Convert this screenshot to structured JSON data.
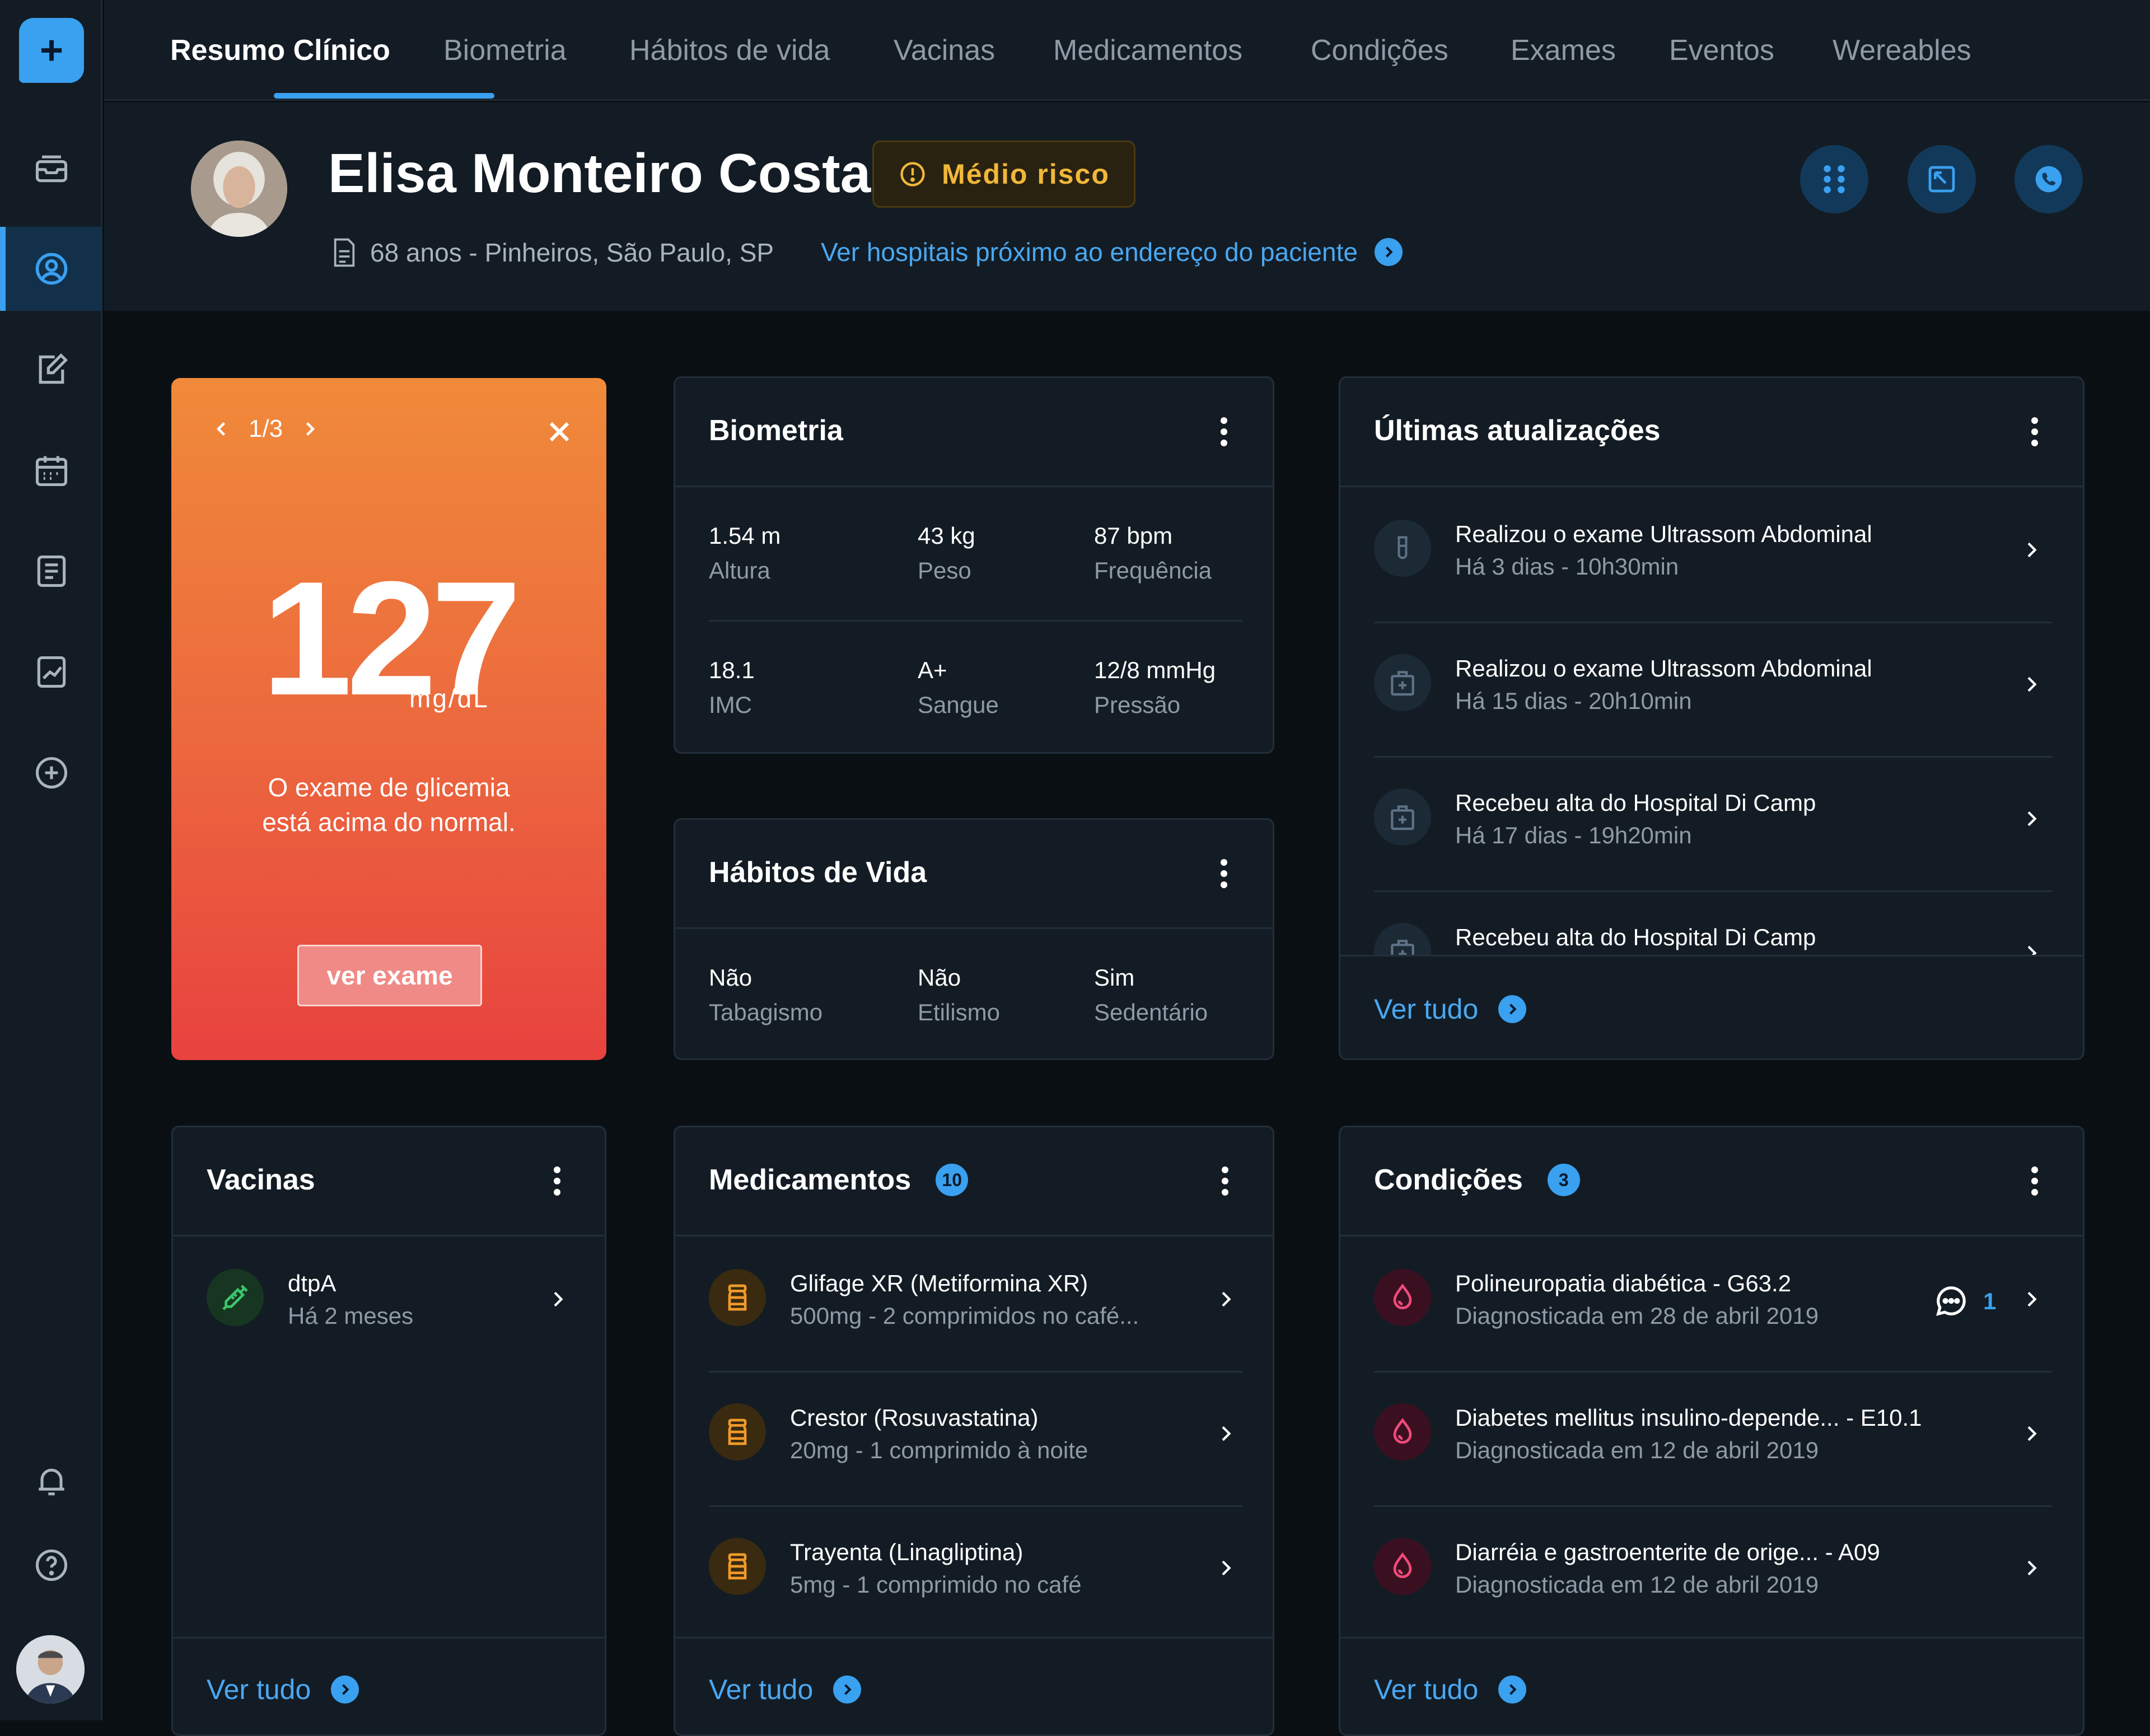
{
  "sidebar": {
    "items": [
      "inbox-icon",
      "user-circle-icon",
      "edit-icon",
      "calendar-icon",
      "document-icon",
      "chart-icon",
      "plus-circle-icon",
      "bell-icon",
      "help-icon"
    ],
    "active": "user-circle-icon",
    "accent": "#3aa0f0"
  },
  "tabs": [
    "Resumo Clínico",
    "Biometria",
    "Hábitos de vida",
    "Vacinas",
    "Medicamentos",
    "Condições",
    "Exames",
    "Eventos",
    "Wereables"
  ],
  "patient": {
    "name": "Elisa Monteiro Costa",
    "risk": "Médio risco",
    "info": "68 anos - Pinheiros, São Paulo, SP",
    "hospital_link": "Ver hospitais próximo ao endereço do paciente"
  },
  "alert": {
    "pager": "1/3",
    "value": "127",
    "unit": "mg/dL",
    "message_line1": "O exame de glicemia",
    "message_line2": "está acima do normal.",
    "button": "ver exame"
  },
  "biometria": {
    "title": "Biometria",
    "metrics": [
      {
        "value": "1.54 m",
        "label": "Altura"
      },
      {
        "value": "43 kg",
        "label": "Peso"
      },
      {
        "value": "87 bpm",
        "label": "Frequência"
      },
      {
        "value": "18.1",
        "label": "IMC"
      },
      {
        "value": "A+",
        "label": "Sangue"
      },
      {
        "value": "12/8 mmHg",
        "label": "Pressão"
      }
    ]
  },
  "habitos": {
    "title": "Hábitos de Vida",
    "metrics": [
      {
        "value": "Não",
        "label": "Tabagismo"
      },
      {
        "value": "Não",
        "label": "Etilismo"
      },
      {
        "value": "Sim",
        "label": "Sedentário"
      }
    ]
  },
  "updates": {
    "title": "Últimas atualizações",
    "items": [
      {
        "title": "Realizou o exame Ultrassom Abdominal",
        "subtitle": "Há 3 dias - 10h30min",
        "icon": "test-tube-icon"
      },
      {
        "title": "Realizou o exame Ultrassom Abdominal",
        "subtitle": "Há 15 dias - 20h10min",
        "icon": "hospital-icon"
      },
      {
        "title": "Recebeu alta do Hospital Di Camp",
        "subtitle": "Há 17 dias - 19h20min",
        "icon": "hospital-icon"
      },
      {
        "title": "Recebeu alta do Hospital Di Camp",
        "subtitle": "",
        "icon": "hospital-icon"
      }
    ],
    "see_all": "Ver tudo"
  },
  "vacinas": {
    "title": "Vacinas",
    "items": [
      {
        "title": "dtpA",
        "subtitle": "Há 2 meses",
        "icon": "syringe-icon"
      }
    ],
    "see_all": "Ver tudo"
  },
  "medicamentos": {
    "title": "Medicamentos",
    "count": "10",
    "items": [
      {
        "title": "Glifage XR (Metiformina XR)",
        "subtitle": "500mg - 2 comprimidos no café..."
      },
      {
        "title": "Crestor (Rosuvastatina)",
        "subtitle": "20mg - 1 comprimido à noite"
      },
      {
        "title": "Trayenta (Linagliptina)",
        "subtitle": "5mg - 1 comprimido no café"
      }
    ],
    "see_all": "Ver tudo"
  },
  "condicoes": {
    "title": "Condições",
    "count": "3",
    "items": [
      {
        "title": "Polineuropatia diabética - G63.2",
        "subtitle": "Diagnosticada em 28 de abril 2019",
        "comments": "1"
      },
      {
        "title": "Diabetes mellitus insulino-depende... - E10.1",
        "subtitle": "Diagnosticada em 12 de abril 2019"
      },
      {
        "title": "Diarréia e gastroenterite de orige... - A09",
        "subtitle": "Diagnosticada em 12 de abril 2019"
      }
    ],
    "see_all": "Ver tudo"
  }
}
